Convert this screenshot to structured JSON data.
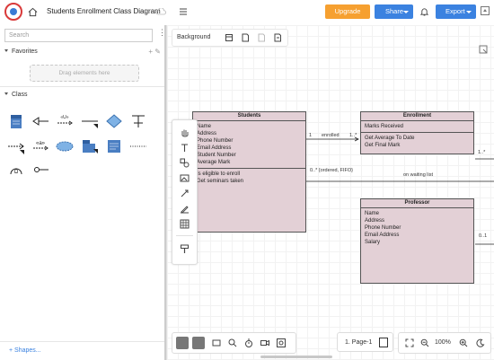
{
  "header": {
    "title": "Students Enrollment Class Diagram",
    "upgrade_label": "Upgrade",
    "share_label": "Share",
    "export_label": "Export"
  },
  "sidebar": {
    "search_placeholder": "Search",
    "favorites_label": "Favorites",
    "drag_hint": "Drag elements here",
    "class_label": "Class",
    "shapes_link": "+ Shapes..."
  },
  "canvas": {
    "background_label": "Background"
  },
  "diagram": {
    "students": {
      "title": "Students",
      "attributes": [
        "Name",
        "Address",
        "Phone Number",
        "Email Address",
        "Student Number",
        "Average Mark"
      ],
      "operations": [
        "Is eligible to enroll",
        "Get seminars taken"
      ]
    },
    "enrollment": {
      "title": "Enrollment",
      "attributes": [
        "Marks Received"
      ],
      "operations": [
        "Get Average To Date",
        "Get Final Mark"
      ]
    },
    "professor": {
      "title": "Professor",
      "attributes": [
        "Name",
        "Address",
        "Phone Number",
        "Email Address",
        "Salary"
      ]
    },
    "relations": {
      "enrolled_label": "enrolled",
      "enrolled_left_mult": "1",
      "enrolled_right_mult": "1..*",
      "waiting_mult": "0..* {ordered, FIFO}",
      "waiting_label": "on waiting list",
      "right_edge_mult_1": "1..*",
      "right_edge_mult_2": "0..1"
    }
  },
  "footer": {
    "page_label": "1. Page-1",
    "zoom_label": "100%"
  },
  "colors": {
    "accent_blue": "#3b82e0",
    "upgrade_orange": "#f6a030",
    "uml_fill": "#e3d0d6"
  }
}
